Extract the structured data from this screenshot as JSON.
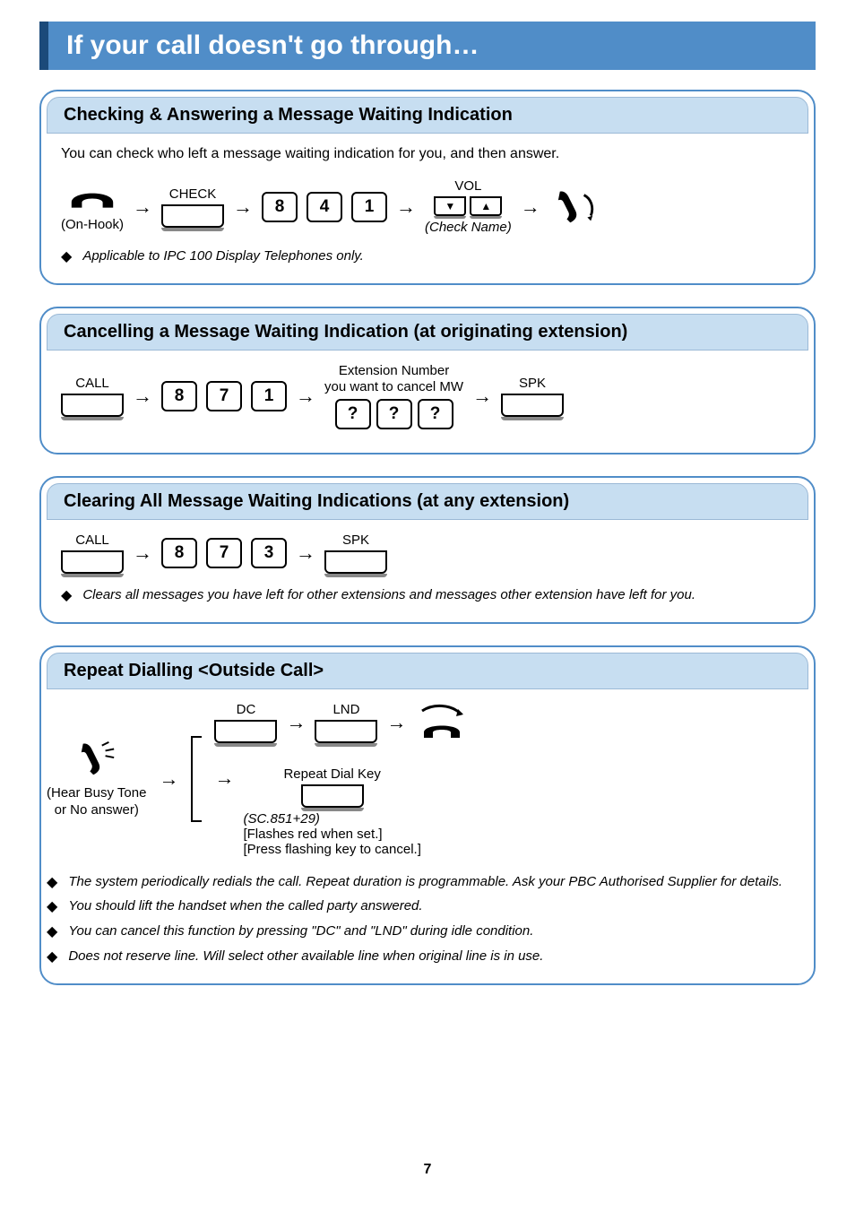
{
  "page": {
    "title": "If your call doesn't go through…",
    "number": "7"
  },
  "section1": {
    "title": "Checking & Answering a Message Waiting Indication",
    "intro": "You can check who left a message waiting indication for you, and then answer.",
    "onhook_label": "(On-Hook)",
    "check_label": "CHECK",
    "digits": [
      "8",
      "4",
      "1"
    ],
    "vol_label": "VOL",
    "checkname_label": "(Check Name)",
    "note1": "Applicable to IPC 100 Display Telephones only."
  },
  "section2": {
    "title": "Cancelling a Message Waiting Indication (at originating extension)",
    "call_label": "CALL",
    "digits": [
      "8",
      "7",
      "1"
    ],
    "ext_label_line1": "Extension Number",
    "ext_label_line2": "you want to cancel MW",
    "ext_digits": [
      "?",
      "?",
      "?"
    ],
    "spk_label": "SPK"
  },
  "section3": {
    "title": "Clearing All Message Waiting Indications (at any extension)",
    "call_label": "CALL",
    "digits": [
      "8",
      "7",
      "3"
    ],
    "spk_label": "SPK",
    "note1": "Clears all messages you have left for other extensions and messages other extension have left for you."
  },
  "section4": {
    "title": "Repeat Dialling <Outside Call>",
    "hear_label_line1": "(Hear Busy Tone",
    "hear_label_line2": "or No answer)",
    "dc_label": "DC",
    "lnd_label": "LND",
    "repeat_label": "Repeat Dial Key",
    "sc_label": "(SC.851+29)",
    "flash_label": "[Flashes red when set.]",
    "press_label": "[Press flashing key to cancel.]",
    "note1": "The system periodically redials the call. Repeat duration is programmable. Ask your PBC Authorised Supplier for details.",
    "note2": "You should lift the handset when the called party answered.",
    "note3": "You can cancel this function by pressing \"DC\" and \"LND\" during idle condition.",
    "note4": "Does not reserve line. Will select other available line when original line is in use."
  }
}
